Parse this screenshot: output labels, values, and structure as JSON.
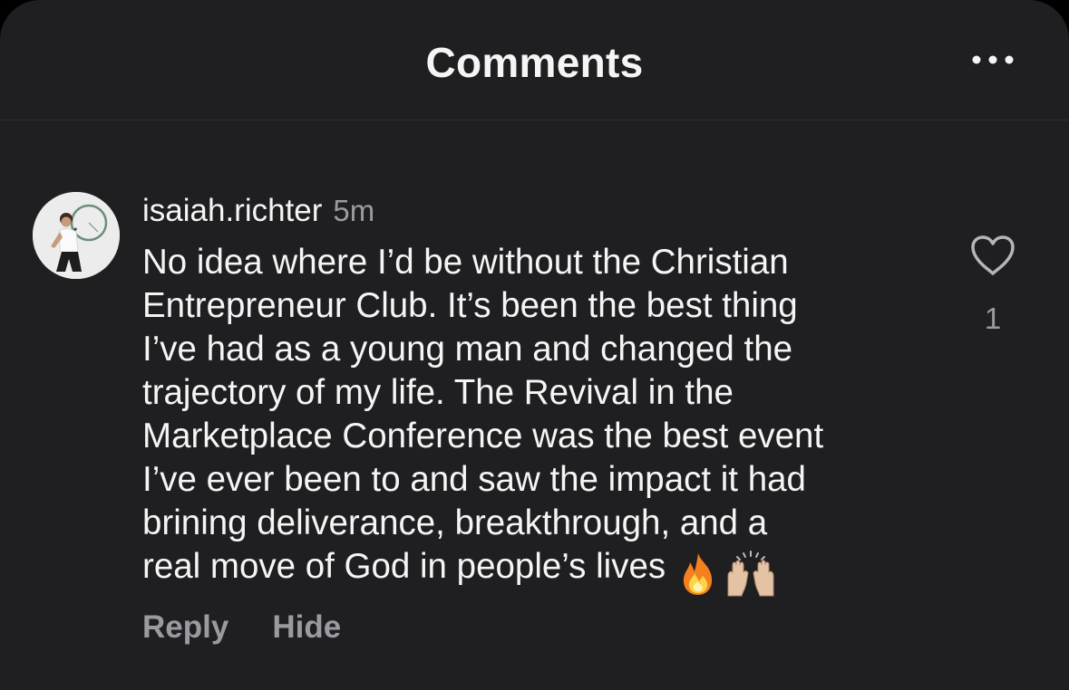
{
  "header": {
    "title": "Comments",
    "more_icon": "more-horizontal-icon"
  },
  "comment": {
    "avatar": "profile-photo",
    "username": "isaiah.richter",
    "timestamp": "5m",
    "text_lines": [
      "No idea where I’d be without the Christian",
      "Entrepreneur Club. It’s been the best thing",
      "I’ve had as a young man and changed the",
      "trajectory of my life.  The Revival in the",
      "Marketplace Conference was the best event",
      "I’ve ever been to and saw the impact it had",
      "brining deliverance, breakthrough, and a",
      "real move of God in people’s lives"
    ],
    "emojis": [
      "🔥",
      "🙌🏼"
    ],
    "like_icon": "heart-icon",
    "like_count": "1",
    "reply_label": "Reply",
    "hide_label": "Hide"
  },
  "colors": {
    "background": "#1f1f22",
    "text_primary": "#f5f5f5",
    "text_secondary": "#9a9aa1",
    "divider": "#2e2e32"
  }
}
